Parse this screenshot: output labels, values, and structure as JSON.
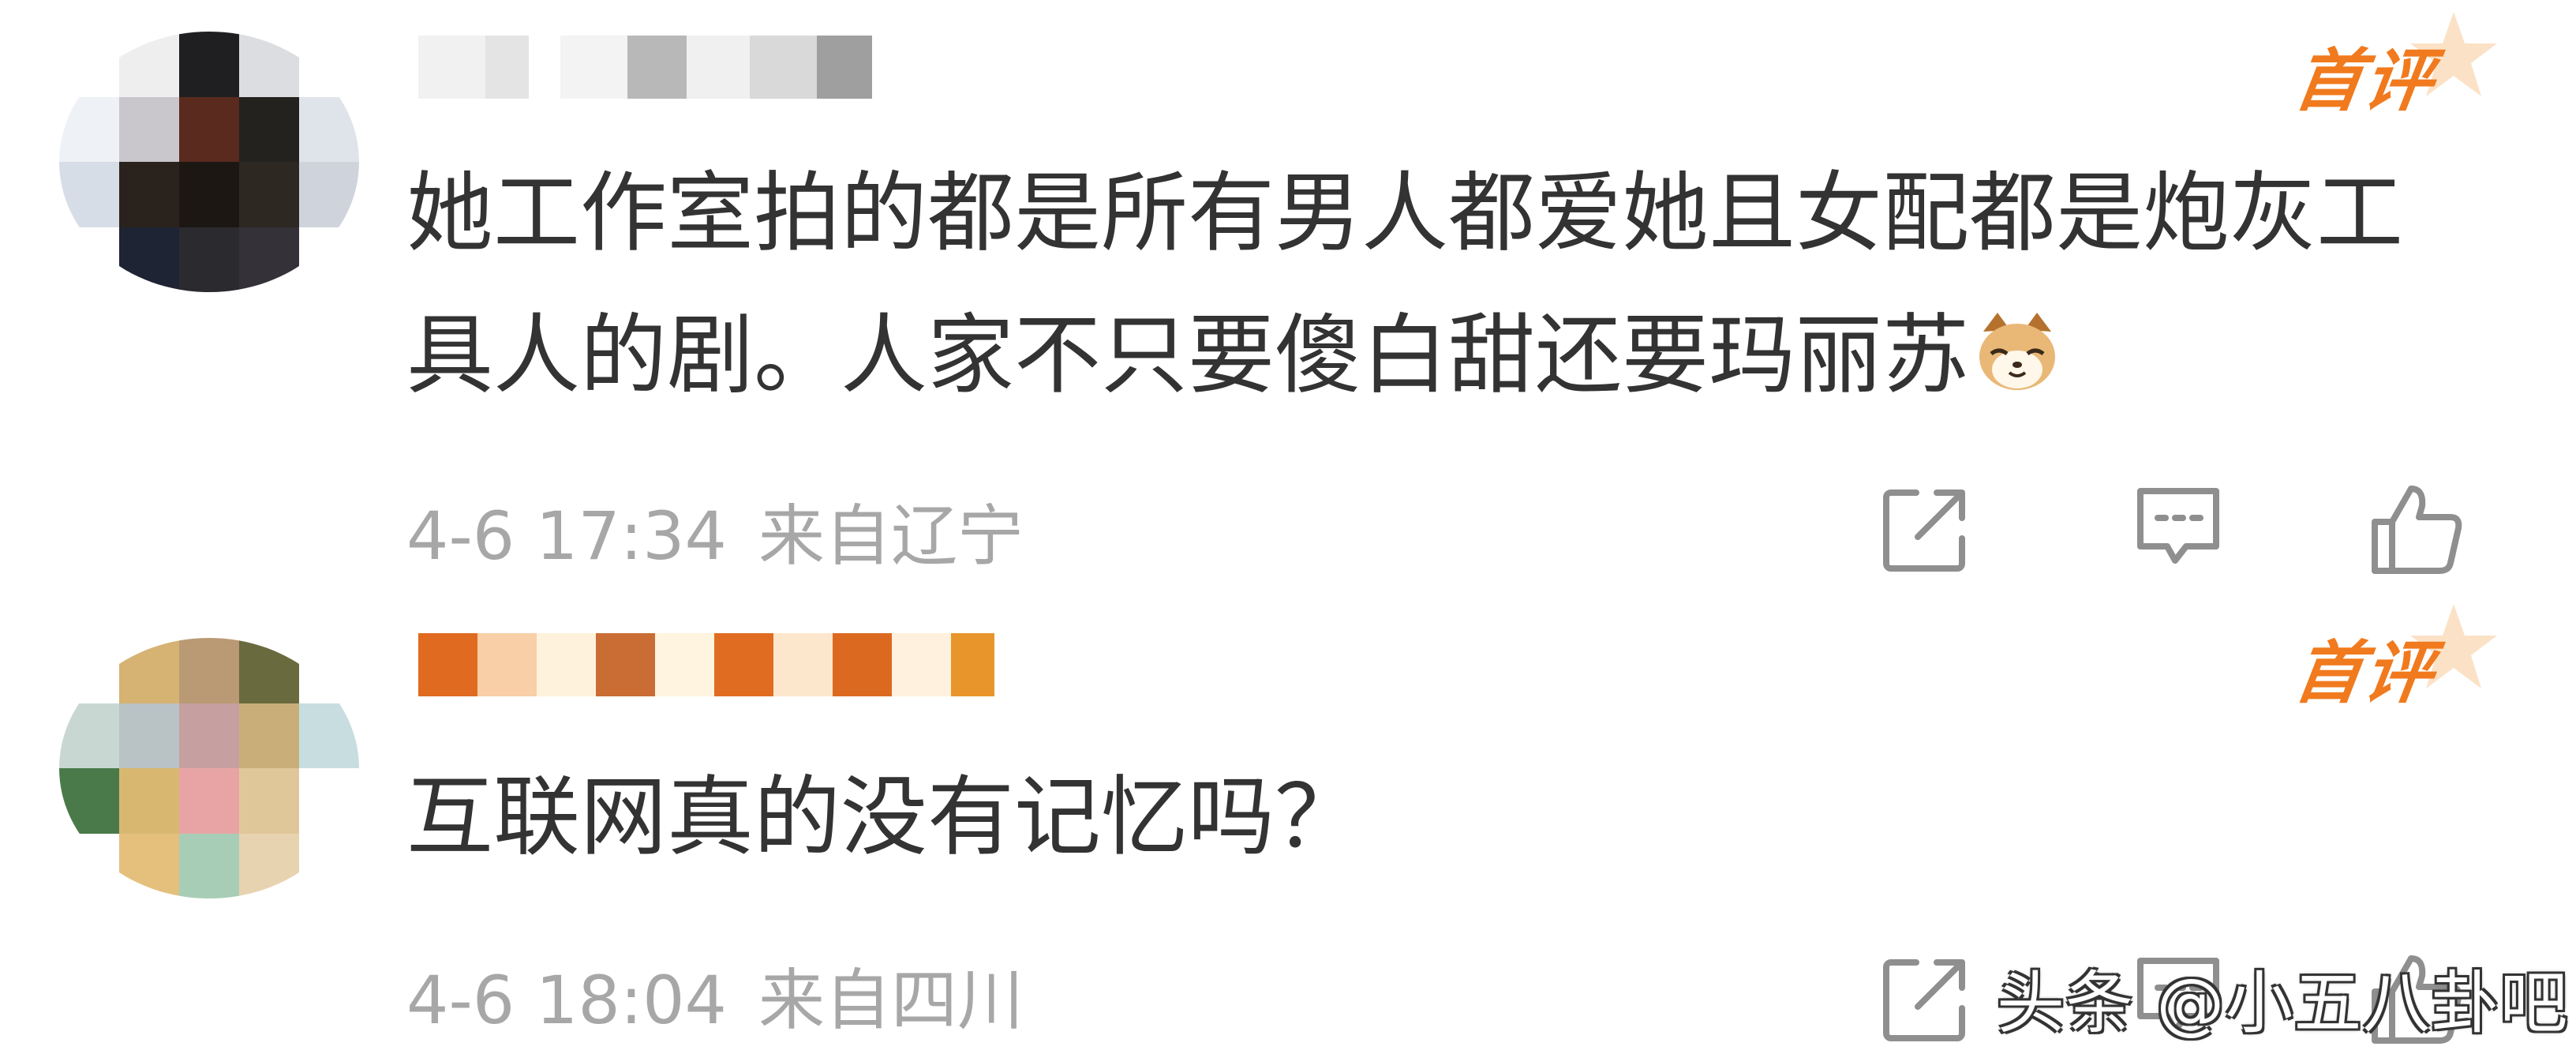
{
  "comments": [
    {
      "badge": "首评",
      "text": "她工作室拍的都是所有男人都爱她且女配都是炮灰工具人的剧。人家不只要傻白甜还要玛丽苏",
      "emoji": "cat-face-emoji",
      "time": "4-6 17:34",
      "location": "来自辽宁"
    },
    {
      "badge": "首评",
      "text": "互联网真的没有记忆吗？",
      "time": "4-6 18:04",
      "location": "来自四川"
    }
  ],
  "watermark": "头条 @小五八卦吧",
  "colors": {
    "badge": "#f07a1d",
    "text": "#333333",
    "meta": "#a7a7a7",
    "icon": "#8f8f8f"
  }
}
